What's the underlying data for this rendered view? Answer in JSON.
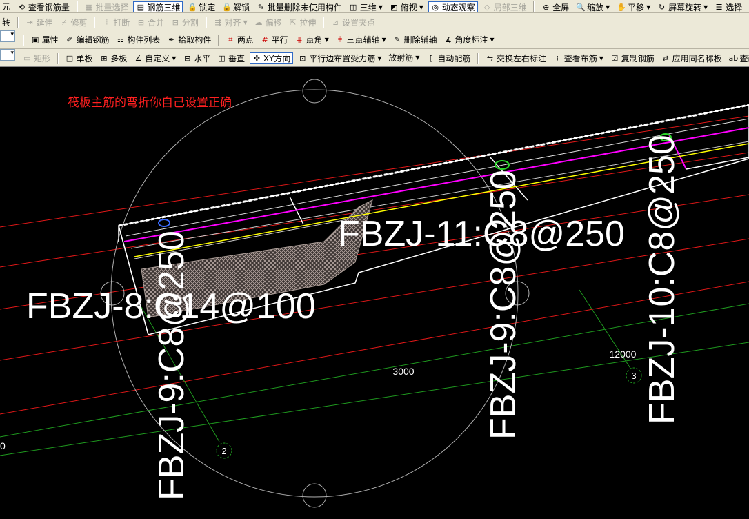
{
  "toolbar1": {
    "items": [
      "元",
      "查看钢筋量",
      "批量选择",
      "钢筋三维",
      "锁定",
      "解锁",
      "批量删除未使用构件",
      "三维",
      "俯视",
      "动态观察",
      "局部三维",
      "全屏",
      "缩放",
      "平移",
      "屏幕旋转",
      "选择"
    ]
  },
  "toolbar2": {
    "items": [
      "转",
      "延伸",
      "修剪",
      "打断",
      "合并",
      "分割",
      "对齐",
      "偏移",
      "拉伸",
      "设置夹点"
    ]
  },
  "toolbar3": {
    "items": [
      "属性",
      "编辑钢筋",
      "构件列表",
      "拾取构件",
      "两点",
      "平行",
      "点角",
      "三点辅轴",
      "删除辅轴",
      "角度标注"
    ]
  },
  "toolbar4": {
    "items": [
      "矩形",
      "单板",
      "多板",
      "自定义",
      "水平",
      "垂直",
      "XY方向",
      "平行边布置受力筋",
      "放射筋",
      "自动配筋",
      "交换左右标注",
      "查看布筋",
      "复制钢筋",
      "应用同名称板",
      "查改标"
    ]
  },
  "canvas": {
    "note": "筏板主筋的弯折你自己设置正确",
    "labels": {
      "fbzj8": "FBZJ-8:C14@100",
      "fbzj9a": "FBZJ-9:C8@250",
      "fbzj9b": "FBZJ-9:C8@250",
      "fbzj10": "FBZJ-10:C8@250",
      "fbzj11": "FBZJ-11:C8@250"
    },
    "dims": {
      "d3000": "3000",
      "d12000": "12000",
      "d0": "0"
    },
    "axes": {
      "a2": "2",
      "a3": "3"
    }
  },
  "colors": {
    "red": "#ff2020",
    "green": "#1f9a1f",
    "magenta": "#ff00ff",
    "yellow": "#ffff00",
    "white": "#ffffff",
    "toolbar": "#ece9d8"
  }
}
